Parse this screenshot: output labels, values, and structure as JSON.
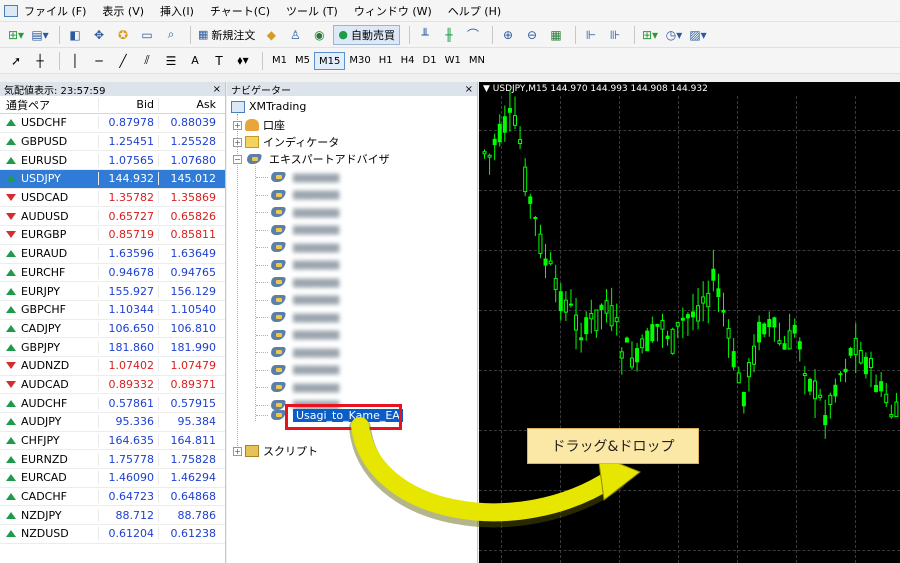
{
  "menubar": {
    "items": [
      "ファイル (F)",
      "表示 (V)",
      "挿入(I)",
      "チャート(C)",
      "ツール (T)",
      "ウィンドウ (W)",
      "ヘルプ (H)"
    ]
  },
  "toolbar": {
    "new_order_label": "新規注文",
    "auto_trade_label": "自動売買",
    "text_tool_label": "A",
    "timeframes": [
      "M1",
      "M5",
      "M15",
      "M30",
      "H1",
      "H4",
      "D1",
      "W1",
      "MN"
    ],
    "active_timeframe": "M15"
  },
  "market_watch": {
    "title": "気配値表示: 23:57:59",
    "close": "×",
    "col_symbol": "通貨ペア",
    "col_bid": "Bid",
    "col_ask": "Ask",
    "rows": [
      {
        "symbol": "USDCHF",
        "bid": "0.87978",
        "ask": "0.88039",
        "dir": "up"
      },
      {
        "symbol": "GBPUSD",
        "bid": "1.25451",
        "ask": "1.25528",
        "dir": "up"
      },
      {
        "symbol": "EURUSD",
        "bid": "1.07565",
        "ask": "1.07680",
        "dir": "up"
      },
      {
        "symbol": "USDJPY",
        "bid": "144.932",
        "ask": "145.012",
        "dir": "up",
        "selected": true
      },
      {
        "symbol": "USDCAD",
        "bid": "1.35782",
        "ask": "1.35869",
        "dir": "down"
      },
      {
        "symbol": "AUDUSD",
        "bid": "0.65727",
        "ask": "0.65826",
        "dir": "down"
      },
      {
        "symbol": "EURGBP",
        "bid": "0.85719",
        "ask": "0.85811",
        "dir": "down"
      },
      {
        "symbol": "EURAUD",
        "bid": "1.63596",
        "ask": "1.63649",
        "dir": "up"
      },
      {
        "symbol": "EURCHF",
        "bid": "0.94678",
        "ask": "0.94765",
        "dir": "up"
      },
      {
        "symbol": "EURJPY",
        "bid": "155.927",
        "ask": "156.129",
        "dir": "up"
      },
      {
        "symbol": "GBPCHF",
        "bid": "1.10344",
        "ask": "1.10540",
        "dir": "up"
      },
      {
        "symbol": "CADJPY",
        "bid": "106.650",
        "ask": "106.810",
        "dir": "up"
      },
      {
        "symbol": "GBPJPY",
        "bid": "181.860",
        "ask": "181.990",
        "dir": "up"
      },
      {
        "symbol": "AUDNZD",
        "bid": "1.07402",
        "ask": "1.07479",
        "dir": "down"
      },
      {
        "symbol": "AUDCAD",
        "bid": "0.89332",
        "ask": "0.89371",
        "dir": "down"
      },
      {
        "symbol": "AUDCHF",
        "bid": "0.57861",
        "ask": "0.57915",
        "dir": "up"
      },
      {
        "symbol": "AUDJPY",
        "bid": "95.336",
        "ask": "95.384",
        "dir": "up"
      },
      {
        "symbol": "CHFJPY",
        "bid": "164.635",
        "ask": "164.811",
        "dir": "up"
      },
      {
        "symbol": "EURNZD",
        "bid": "1.75778",
        "ask": "1.75828",
        "dir": "up"
      },
      {
        "symbol": "EURCAD",
        "bid": "1.46090",
        "ask": "1.46294",
        "dir": "up"
      },
      {
        "symbol": "CADCHF",
        "bid": "0.64723",
        "ask": "0.64868",
        "dir": "up"
      },
      {
        "symbol": "NZDJPY",
        "bid": "88.712",
        "ask": "88.786",
        "dir": "up"
      },
      {
        "symbol": "NZDUSD",
        "bid": "0.61204",
        "ask": "0.61238",
        "dir": "up"
      }
    ]
  },
  "navigator": {
    "title": "ナビゲーター",
    "close": "×",
    "root": "XMTrading",
    "accounts": "口座",
    "indicators": "インディケータ",
    "experts": "エキスパートアドバイザ",
    "highlighted_ea": "Usagi_to_Kame_EA",
    "scripts": "スクリプト"
  },
  "chart": {
    "title": "USDJPY,M15  144.970 144.993 144.908 144.932",
    "candle_color": "#00ff00",
    "background": "#000000"
  },
  "tooltip": {
    "label": "ドラッグ&ドロップ"
  },
  "colors": {
    "up_price": "#1d3fd0",
    "down_price": "#d61f1f",
    "selection": "#2f7bd6",
    "highlight_box": "#e8121f",
    "arrow": "#e6e600"
  }
}
